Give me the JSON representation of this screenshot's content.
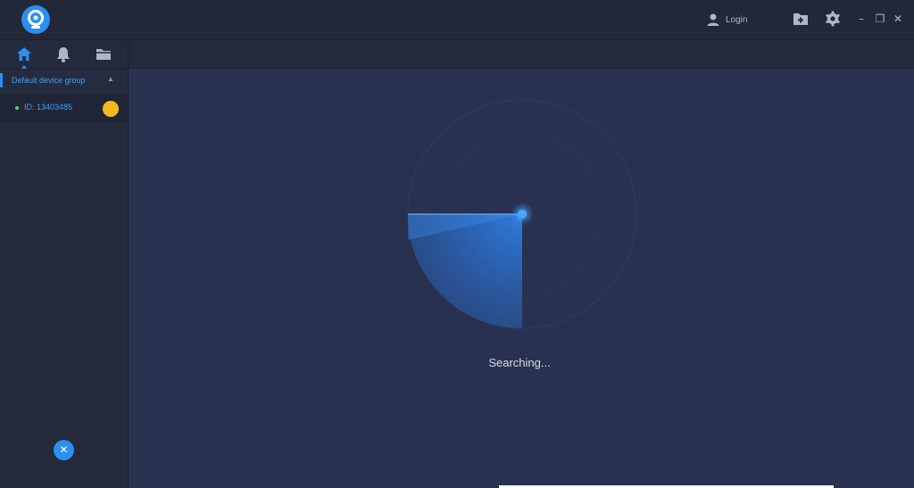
{
  "titlebar": {
    "login_label": "Login",
    "icons": [
      "app-logo-icon",
      "user-icon",
      "folder-plus-icon",
      "gear-icon"
    ],
    "window_controls": {
      "minimize": "–",
      "restore": "❐",
      "close": "✕"
    }
  },
  "sidebar": {
    "tabs": [
      {
        "name": "home-icon",
        "active": true
      },
      {
        "name": "bell-icon",
        "active": false
      },
      {
        "name": "folder-icon",
        "active": false
      }
    ],
    "group": {
      "label": "Default device group",
      "caret": "▲"
    },
    "device": {
      "label": "ID: 13403485",
      "status_color": "#52d56a",
      "badge_color": "#f4b81a"
    },
    "close_button": "✕"
  },
  "main": {
    "status_text": "Searching..."
  },
  "colors": {
    "accent": "#2b8ff0",
    "background": "#283250",
    "sidebar": "#242a3b"
  }
}
